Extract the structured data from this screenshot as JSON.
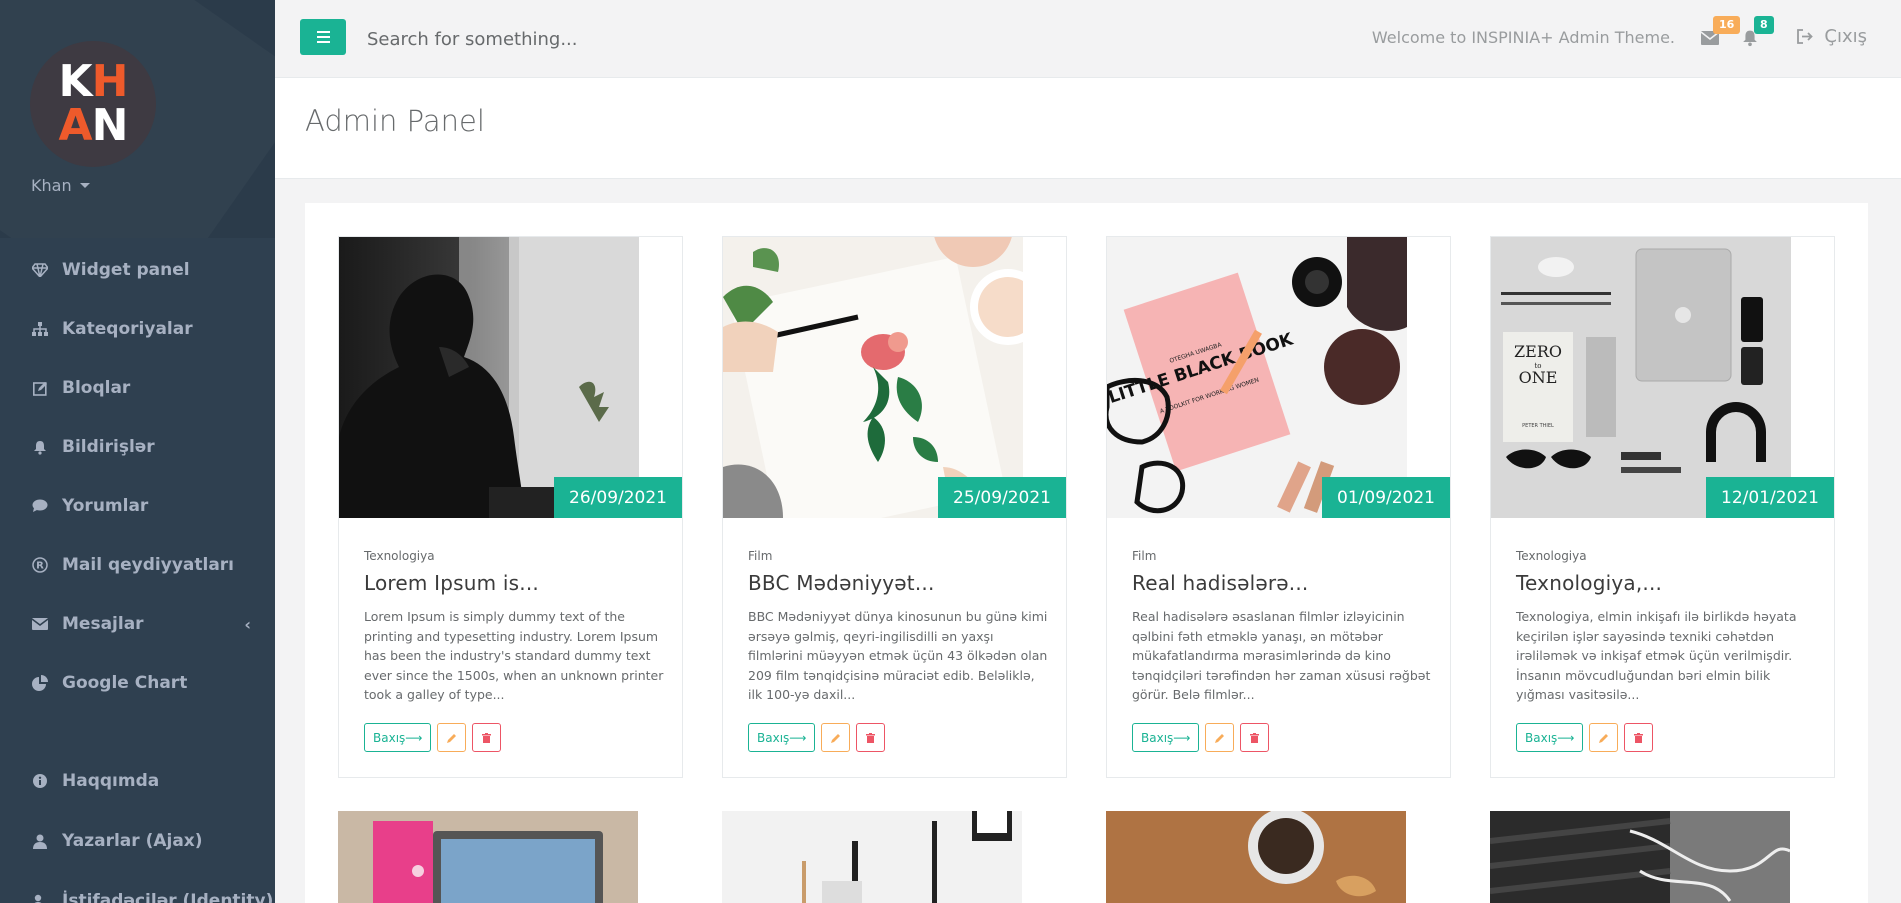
{
  "sidebar": {
    "logo": {
      "row1": [
        "K",
        "H"
      ],
      "row2": [
        "A",
        "N"
      ]
    },
    "profile_name": "Khan",
    "items": [
      {
        "label": "Widget panel",
        "icon": "diamond-icon"
      },
      {
        "label": "Kateqoriyalar",
        "icon": "sitemap-icon"
      },
      {
        "label": "Bloqlar",
        "icon": "edit-icon"
      },
      {
        "label": "Bildirişlər",
        "icon": "bell-icon"
      },
      {
        "label": "Yorumlar",
        "icon": "comment-icon"
      },
      {
        "label": "Mail qeydiyyatları",
        "icon": "registered-icon"
      },
      {
        "label": "Mesajlar",
        "icon": "envelope-icon"
      },
      {
        "label": "Google Chart",
        "icon": "pie-chart-icon"
      },
      {
        "label": "Haqqımda",
        "icon": "info-icon"
      },
      {
        "label": "Yazarlar (Ajax)",
        "icon": "user-icon"
      },
      {
        "label": "İstifadəçilər (Identity)",
        "icon": "users-icon"
      }
    ],
    "messages_arrow": "‹"
  },
  "topbar": {
    "search_placeholder": "Search for something...",
    "welcome": "Welcome to INSPINIA+ Admin Theme.",
    "mail_count": "16",
    "notify_count": "8",
    "logout_label": "Çıxış",
    "colors": {
      "accent": "#1ab394",
      "warning": "#f8ac59"
    }
  },
  "page": {
    "title": "Admin Panel"
  },
  "posts": [
    {
      "date": "26/09/2021",
      "category": "Texnologiya",
      "title": "Lorem Ipsum is...",
      "description": "Lorem Ipsum is simply dummy text of the printing and typesetting industry. Lorem Ipsum has been the industry's standard dummy text ever since the 1500s, when an unknown printer took a galley of type...",
      "view_label": "Baxış⟶"
    },
    {
      "date": "25/09/2021",
      "category": "Film",
      "title": "BBC Mədəniyyət...",
      "description": "BBC Mədəniyyət dünya kinosunun bu günə kimi ərsəyə gəlmiş, qeyri-ingilisdilli ən yaxşı filmlərini müəyyən etmək üçün 43 ölkədən olan 209 film tənqidçisinə müraciət edib. Beləliklə, ilk 100-yə daxil...",
      "view_label": "Baxış⟶"
    },
    {
      "date": "01/09/2021",
      "category": "Film",
      "title": "Real hadisələrə...",
      "description": "Real hadisələrə əsaslanan filmlər izləyicinin qəlbini fəth etməklə yanaşı, ən mötəbər mükafatlandırma mərasimlərində də kino tənqidçiləri tərəfindən hər zaman xüsusi rəğbət görür. Belə filmlər...",
      "view_label": "Baxış⟶"
    },
    {
      "date": "12/01/2021",
      "category": "Texnologiya",
      "title": "Texnologiya,...",
      "description": "Texnologiya, elmin inkişafı ilə birlikdə həyata keçirilən işlər sayəsində texniki cəhətdən irəliləmək və inkişaf etmək üçün verilmişdir. İnsanın mövcudluğundan bəri elmin bilik yığması vasitəsilə...",
      "view_label": "Baxış⟶"
    }
  ],
  "book_cover": {
    "top": "OTEGHA UWAGBA",
    "title": "LITTLE BLACK BOOK",
    "subtitle": "A TOOLKIT FOR WORKING WOMEN"
  },
  "zero_book": {
    "title1": "ZERO",
    "to": "to",
    "title2": "ONE",
    "author": "PETER THIEL"
  }
}
